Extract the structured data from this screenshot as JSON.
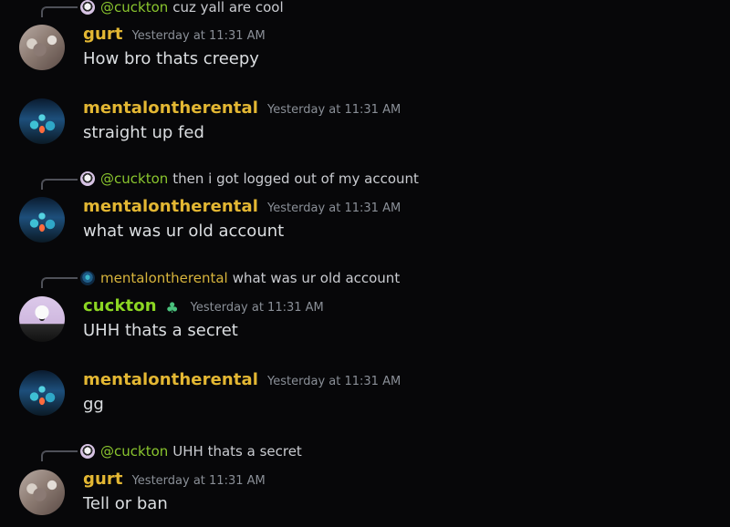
{
  "messages": [
    {
      "reply": {
        "mention": "@cuckton",
        "text": "cuz yall are cool"
      },
      "author": "gurt",
      "timestamp": "Yesterday at 11:31 AM",
      "content": "How bro thats creepy"
    },
    {
      "author": "mentalontherental",
      "timestamp": "Yesterday at 11:31 AM",
      "content": "straight up fed"
    },
    {
      "reply": {
        "mention": "@cuckton",
        "text": "then i got logged out of my account"
      },
      "author": "mentalontherental",
      "timestamp": "Yesterday at 11:31 AM",
      "content": "what was ur old account"
    },
    {
      "reply": {
        "mention": "mentalontherental",
        "text": "what was ur old account"
      },
      "author": "cuckton",
      "badge": "clover-icon",
      "timestamp": "Yesterday at 11:31 AM",
      "content": "UHH thats a secret"
    },
    {
      "author": "mentalontherental",
      "timestamp": "Yesterday at 11:31 AM",
      "content": "gg"
    },
    {
      "reply": {
        "mention": "@cuckton",
        "text": "UHH thats a secret"
      },
      "author": "gurt",
      "timestamp": "Yesterday at 11:31 AM",
      "content": "Tell or ban"
    }
  ],
  "colors": {
    "background": "#070709",
    "author_gold": "#e3b733",
    "author_green": "#8cd623",
    "timestamp": "#8a8f97",
    "message_text": "#dbdee1"
  }
}
